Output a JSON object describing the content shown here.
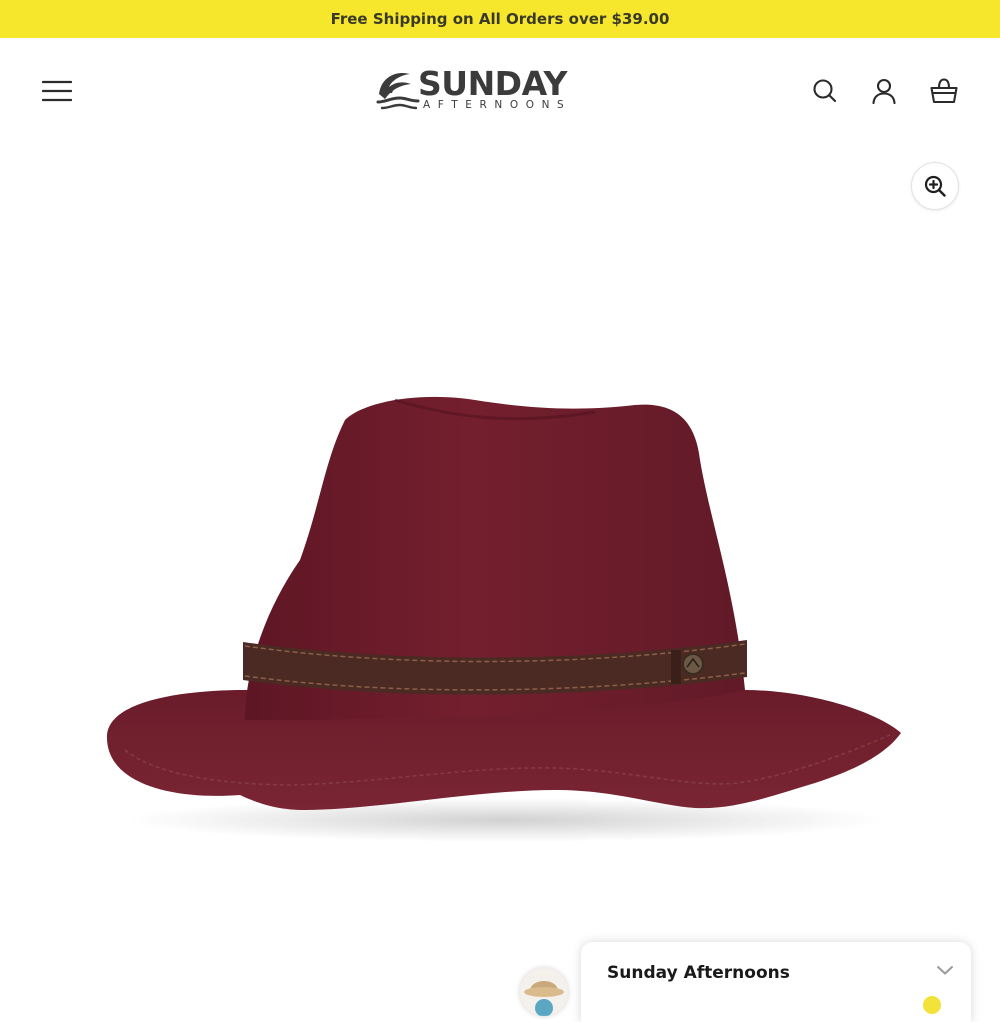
{
  "promo_bar": {
    "text": "Free Shipping on All Orders over $39.00",
    "background": "#f7e72c"
  },
  "header": {
    "logo": {
      "wordmark": "SUNDAY",
      "subline": "AFTERNOONS"
    },
    "icons": [
      "menu-icon",
      "search-icon",
      "account-icon",
      "cart-icon"
    ]
  },
  "gallery": {
    "zoom_icon": "zoom-in-icon",
    "product_image": "burgundy-felt-fedora-hat",
    "hat_color": "#6e1f2b"
  },
  "chat": {
    "title": "Sunday Afternoons",
    "toggle_icon": "chevron-down-icon"
  }
}
